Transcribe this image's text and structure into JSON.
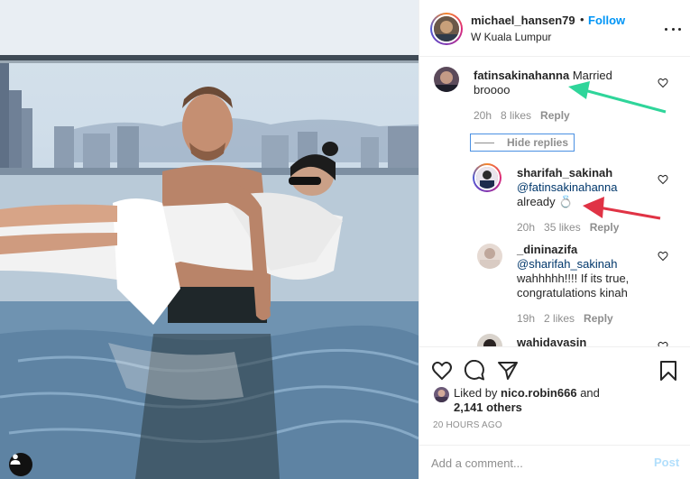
{
  "post": {
    "author": "michael_hansen79",
    "dot": "•",
    "follow_label": "Follow",
    "location": "W Kuala Lumpur"
  },
  "comments": [
    {
      "username": "fatinsakinahanna",
      "text": "Married broooo",
      "time": "20h",
      "likes": "8 likes",
      "reply_label": "Reply"
    }
  ],
  "hide_replies_label": "Hide replies",
  "replies": [
    {
      "username": "sharifah_sakinah",
      "mention": "@fatinsakinahanna",
      "text": "already",
      "emoji": "💍",
      "time": "20h",
      "likes": "35 likes",
      "reply_label": "Reply"
    },
    {
      "username": "_dininazifa",
      "mention": "@sharifah_sakinah",
      "text_line1": "wahhhhh!!!! If its true,",
      "text_line2": "congratulations kinah",
      "time": "19h",
      "likes": "2 likes",
      "reply_label": "Reply"
    },
    {
      "username": "wahidayasin"
    }
  ],
  "likes_summary": {
    "prefix": "Liked by ",
    "user": "nico.robin666",
    "connector": " and",
    "others": "2,141 others"
  },
  "time_ago": "20 HOURS AGO",
  "add_comment": {
    "placeholder": "Add a comment...",
    "post_label": "Post"
  },
  "icons": {
    "like": "heart-icon",
    "comment": "comment-icon",
    "share": "share-icon",
    "save": "bookmark-icon",
    "tag": "person-icon"
  },
  "colors": {
    "link_blue": "#0095f6",
    "annotation_green": "#2fd59a",
    "annotation_red": "#e03345"
  }
}
